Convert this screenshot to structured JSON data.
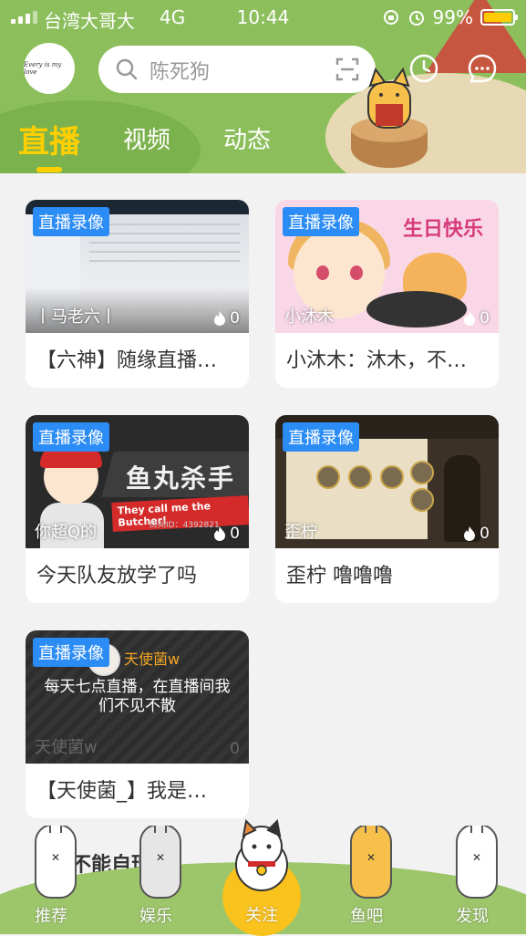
{
  "status_bar": {
    "carrier": "台湾大哥大",
    "network": "4G",
    "time": "10:44",
    "battery": "99%",
    "battery_color": "#ffcc00"
  },
  "header": {
    "avatar_text": "Every is my love",
    "search": {
      "placeholder": "陈死狗"
    },
    "icons": [
      "search-icon",
      "scan-icon",
      "clock-icon",
      "message-icon"
    ]
  },
  "tabs": [
    {
      "label": "直播",
      "active": true
    },
    {
      "label": "视频",
      "active": false
    },
    {
      "label": "动态",
      "active": false
    }
  ],
  "colors": {
    "accent": "#ffcf00",
    "badge": "#2b8cf5",
    "header_bg": "#8cbf5c"
  },
  "cards": [
    {
      "badge": "直播录像",
      "streamer": "丨马老六丨",
      "heat": "0",
      "title": "【六神】随缘直播…"
    },
    {
      "badge": "直播录像",
      "streamer": "小沐木",
      "heat": "0",
      "title": "小沐木：沐木，不…",
      "thumb_text": "生日快乐"
    },
    {
      "badge": "直播录像",
      "streamer": "你超Q的",
      "heat": "0",
      "title": "今天队友放学了吗",
      "thumb_text": "鱼丸杀手",
      "thumb_banner": "They call me the Butcher!",
      "thumb_room": "房间ID：4392821"
    },
    {
      "badge": "直播录像",
      "streamer": "歪柠",
      "heat": "0",
      "title": "歪柠 噜噜噜"
    },
    {
      "badge": "直播录像",
      "streamer": "天使菌w",
      "heat": "0",
      "title": "【天使菌_】我是…",
      "thumb_user": "天使菌w",
      "thumb_message": "每天七点直播，在直播间我们不见不散"
    }
  ],
  "peek_text": "不能自理",
  "bottom_nav": [
    {
      "label": "推荐"
    },
    {
      "label": "娱乐"
    },
    {
      "label": "关注",
      "active": true
    },
    {
      "label": "鱼吧"
    },
    {
      "label": "发现"
    }
  ]
}
